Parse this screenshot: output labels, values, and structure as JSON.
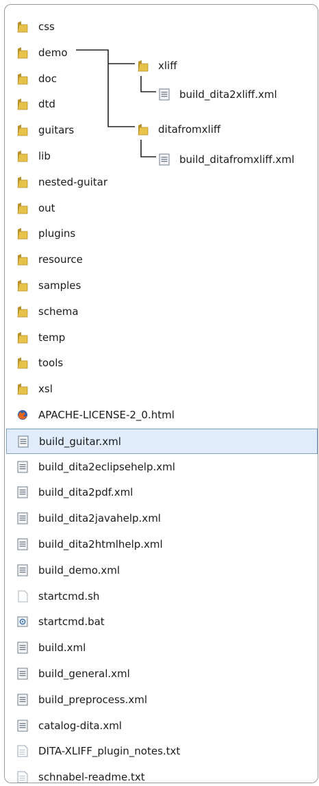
{
  "items": [
    {
      "label": "css",
      "icon": "folder-icon"
    },
    {
      "label": "demo",
      "icon": "folder-icon"
    },
    {
      "label": "doc",
      "icon": "folder-icon"
    },
    {
      "label": "dtd",
      "icon": "folder-icon"
    },
    {
      "label": "guitars",
      "icon": "folder-icon"
    },
    {
      "label": "lib",
      "icon": "folder-icon"
    },
    {
      "label": "nested-guitar",
      "icon": "folder-icon"
    },
    {
      "label": "out",
      "icon": "folder-icon"
    },
    {
      "label": "plugins",
      "icon": "folder-icon"
    },
    {
      "label": "resource",
      "icon": "folder-icon"
    },
    {
      "label": "samples",
      "icon": "folder-icon"
    },
    {
      "label": "schema",
      "icon": "folder-icon"
    },
    {
      "label": "temp",
      "icon": "folder-icon"
    },
    {
      "label": "tools",
      "icon": "folder-icon"
    },
    {
      "label": "xsl",
      "icon": "folder-icon"
    },
    {
      "label": "APACHE-LICENSE-2_0.html",
      "icon": "firefox-icon"
    },
    {
      "label": "build_guitar.xml",
      "icon": "xml-file-icon",
      "selected": true
    },
    {
      "label": "build_dita2eclipsehelp.xml",
      "icon": "xml-file-icon"
    },
    {
      "label": "build_dita2pdf.xml",
      "icon": "xml-file-icon"
    },
    {
      "label": "build_dita2javahelp.xml",
      "icon": "xml-file-icon"
    },
    {
      "label": "build_dita2htmlhelp.xml",
      "icon": "xml-file-icon"
    },
    {
      "label": "build_demo.xml",
      "icon": "xml-file-icon"
    },
    {
      "label": "startcmd.sh",
      "icon": "blank-file-icon"
    },
    {
      "label": "startcmd.bat",
      "icon": "batch-file-icon"
    },
    {
      "label": "build.xml",
      "icon": "xml-file-icon"
    },
    {
      "label": "build_general.xml",
      "icon": "xml-file-icon"
    },
    {
      "label": "build_preprocess.xml",
      "icon": "xml-file-icon"
    },
    {
      "label": "catalog-dita.xml",
      "icon": "xml-file-icon"
    },
    {
      "label": "DITA-XLIFF_plugin_notes.txt",
      "icon": "text-file-icon"
    },
    {
      "label": "schnabel-readme.txt",
      "icon": "text-file-icon"
    }
  ],
  "demo_children": [
    {
      "label": "xliff",
      "icon": "folder-icon"
    },
    {
      "label": "build_dita2xliff.xml",
      "icon": "xml-file-icon"
    },
    {
      "label": "ditafromxliff",
      "icon": "folder-icon"
    },
    {
      "label": "build_ditafromxliff.xml",
      "icon": "xml-file-icon"
    }
  ],
  "colors": {
    "folder": "#e6c24a",
    "folder_dark": "#b9902a",
    "selection_bg": "#e0ecfb",
    "selection_border": "#7da2ce",
    "connector": "#222222"
  }
}
